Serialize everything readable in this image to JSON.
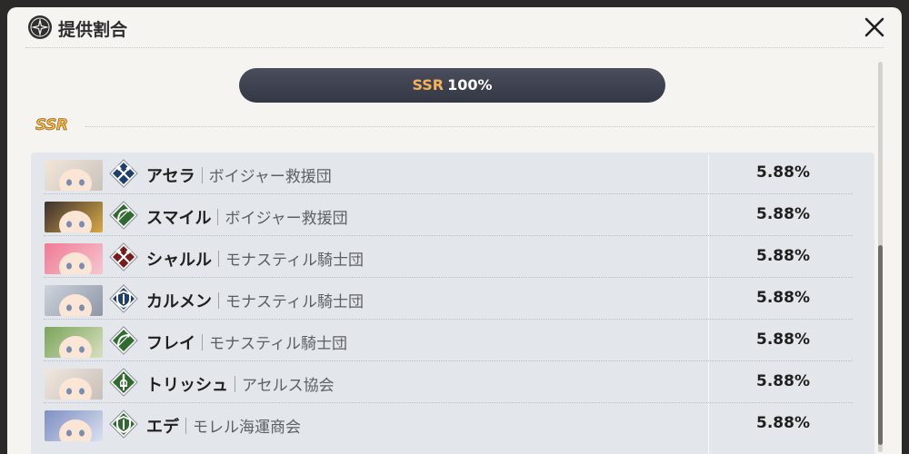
{
  "dialog": {
    "title": "提供割合",
    "icons": {
      "logo": "compass-star-icon",
      "close": "close-icon"
    }
  },
  "summary": {
    "rank": "SSR",
    "rate": "100%"
  },
  "section": {
    "label": "SSR"
  },
  "characters": [
    {
      "name": "アセラ",
      "faction": "ボイジャー救援団",
      "rate": "5.88%",
      "class_icon": "crossed-hammers-icon",
      "class_color": "#1e3f6e",
      "portrait_colors": [
        "#f3e6d8",
        "#c9c3bd"
      ]
    },
    {
      "name": "スマイル",
      "faction": "ボイジャー救援団",
      "rate": "5.88%",
      "class_icon": "bow-icon",
      "class_color": "#2f6a2e",
      "portrait_colors": [
        "#3a3030",
        "#d9a944"
      ]
    },
    {
      "name": "シャルル",
      "faction": "モナスティル騎士団",
      "rate": "5.88%",
      "class_icon": "crossed-hammers-icon",
      "class_color": "#7a1b1b",
      "portrait_colors": [
        "#f07a96",
        "#f6c6cf"
      ]
    },
    {
      "name": "カルメン",
      "faction": "モナスティル騎士団",
      "rate": "5.88%",
      "class_icon": "shield-icon",
      "class_color": "#1e3f6e",
      "portrait_colors": [
        "#cfd4dc",
        "#8e96a6"
      ]
    },
    {
      "name": "フレイ",
      "faction": "モナスティル騎士団",
      "rate": "5.88%",
      "class_icon": "bow-icon",
      "class_color": "#2f6a2e",
      "portrait_colors": [
        "#7aa45a",
        "#d8e0c0"
      ]
    },
    {
      "name": "トリッシュ",
      "faction": "アセルス協会",
      "rate": "5.88%",
      "class_icon": "sword-icon",
      "class_color": "#2f6a2e",
      "portrait_colors": [
        "#f0e8df",
        "#c8c0b8"
      ]
    },
    {
      "name": "エデ",
      "faction": "モレル海運商会",
      "rate": "5.88%",
      "class_icon": "shield-icon",
      "class_color": "#2f6a2e",
      "portrait_colors": [
        "#7e8fc2",
        "#d9e0f0"
      ]
    }
  ],
  "colors": {
    "panel_bg": "#f6f4f1",
    "list_bg": "#e3e6ea",
    "pill_bg": "#3b3e4b",
    "ssr_gold": "#f7b53c"
  }
}
